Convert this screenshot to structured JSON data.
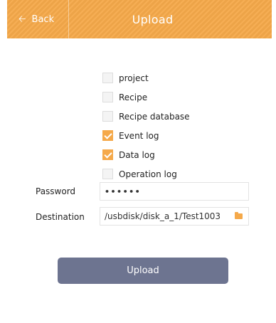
{
  "header": {
    "back_label": "Back",
    "title": "Upload",
    "color": "#f5a94a"
  },
  "options": [
    {
      "label": "project",
      "checked": false
    },
    {
      "label": "Recipe",
      "checked": false
    },
    {
      "label": "Recipe database",
      "checked": false
    },
    {
      "label": "Event log",
      "checked": true
    },
    {
      "label": "Data log",
      "checked": true
    },
    {
      "label": "Operation log",
      "checked": false
    }
  ],
  "password": {
    "label": "Password",
    "value": "••••••"
  },
  "destination": {
    "label": "Destination",
    "value": "/usbdisk/disk_a_1/Test1003",
    "icon": "folder-icon"
  },
  "upload_button": {
    "label": "Upload",
    "color": "#6d7490"
  }
}
